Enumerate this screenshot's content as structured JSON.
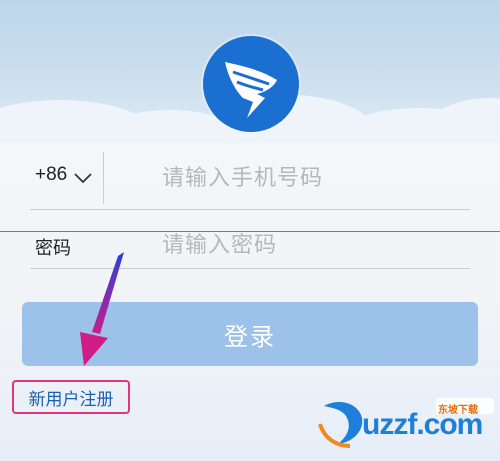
{
  "login": {
    "country_code": "+86",
    "phone_placeholder": "请输入手机号码",
    "password_label": "密码",
    "password_placeholder": "请输入密码",
    "login_button": "登录",
    "register_link": "新用户注册"
  },
  "watermark": {
    "text": "uzzf.com",
    "tag": "东坡下载"
  },
  "colors": {
    "brand_blue": "#1a6fd0",
    "button_bg": "#9cc2ea",
    "highlight_pink": "#e0357a"
  },
  "icons": [
    "dingtalk-logo-icon",
    "chevron-down-icon",
    "annotation-arrow-icon",
    "uzzf-logo-icon"
  ]
}
